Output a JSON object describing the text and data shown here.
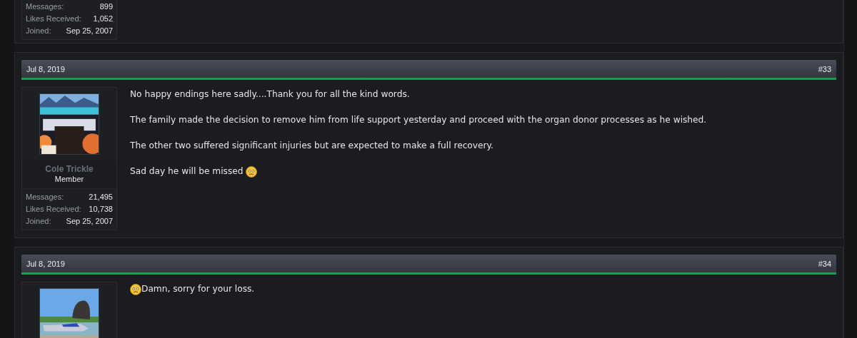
{
  "posts": [
    {
      "user": {
        "stats": [
          {
            "label": "Messages:",
            "value": "899"
          },
          {
            "label": "Likes Received:",
            "value": "1,052"
          },
          {
            "label": "Joined:",
            "value": "Sep 25, 2007"
          }
        ]
      }
    },
    {
      "date": "Jul 8, 2019",
      "number": "#33",
      "user": {
        "name": "Cole Trickle",
        "title": "Member",
        "stats": [
          {
            "label": "Messages:",
            "value": "21,495"
          },
          {
            "label": "Likes Received:",
            "value": "10,738"
          },
          {
            "label": "Joined:",
            "value": "Sep 25, 2007"
          }
        ]
      },
      "paragraphs": [
        {
          "kind": "plain",
          "text": "No happy endings here sadly....Thank you for all the kind words."
        },
        {
          "kind": "plain",
          "text": "The family made the decision to remove him from life support yesterday and proceed with the organ donor processes as he wished."
        },
        {
          "kind": "plain",
          "text": "The other two suffered significant injuries but are expected to make a full recovery."
        },
        {
          "kind": "emoji_after",
          "text": "Sad day he will be missed"
        }
      ]
    },
    {
      "date": "Jul 8, 2019",
      "number": "#34",
      "paragraphs": [
        {
          "kind": "emoji_before",
          "text": "Damn, sorry for your loss."
        }
      ]
    }
  ]
}
